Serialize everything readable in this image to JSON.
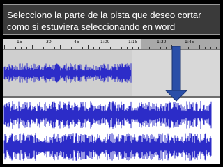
{
  "caption": {
    "line1": "Selecciono la parte de la pista que deseo cortar",
    "line2": "como si estuviera seleccionando en word"
  },
  "ruler": {
    "labels": [
      "15",
      "30",
      "45",
      "1:00",
      "1:15",
      "1:30",
      "1:45"
    ]
  },
  "colors": {
    "waveform": "#2c2cc8",
    "arrow": "#2a4fa8",
    "selection": "#d8d8d8"
  },
  "icons": {
    "arrow": "down-arrow-icon"
  }
}
